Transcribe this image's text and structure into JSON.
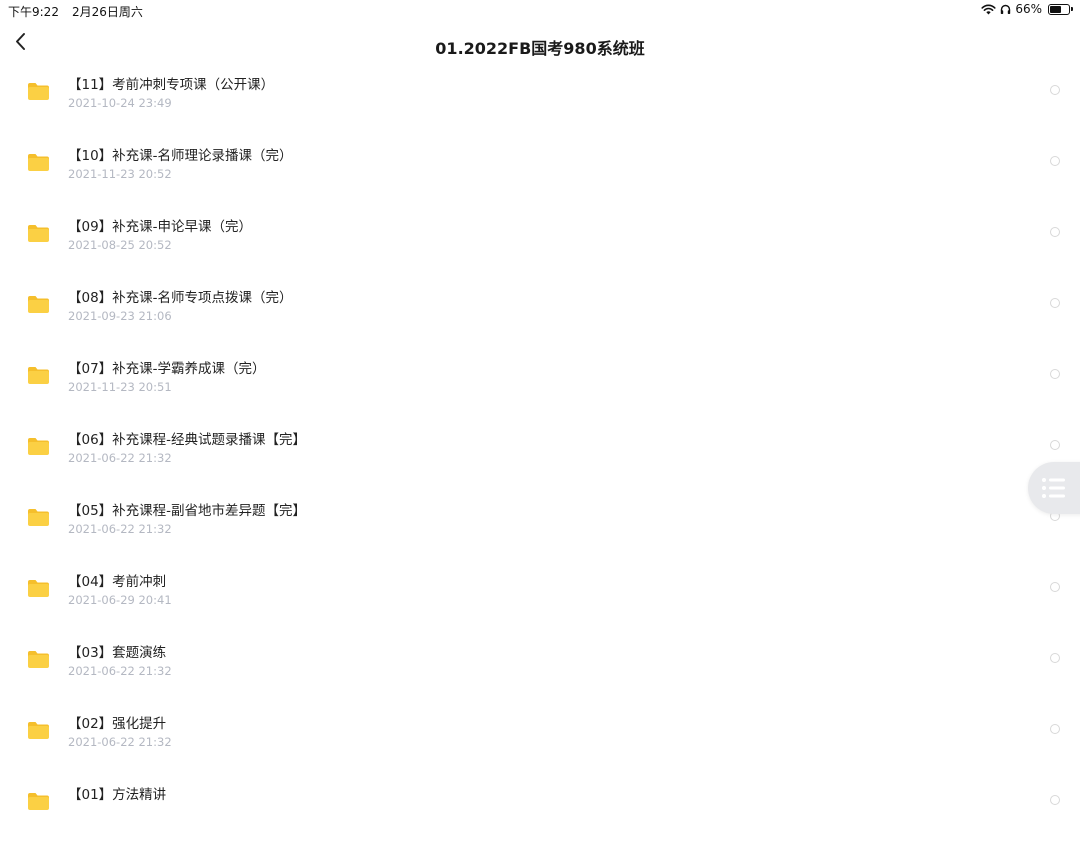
{
  "status_bar": {
    "time": "下午9:22",
    "date": "2月26日周六",
    "battery": "66%"
  },
  "nav": {
    "title": "01.2022FB国考980系统班"
  },
  "folders": [
    {
      "name": "【11】考前冲刺专项课（公开课）",
      "date": "2021-10-24 23:49"
    },
    {
      "name": "【10】补充课-名师理论录播课（完）",
      "date": "2021-11-23 20:52"
    },
    {
      "name": "【09】补充课-申论早课（完）",
      "date": "2021-08-25 20:52"
    },
    {
      "name": "【08】补充课-名师专项点拨课（完）",
      "date": "2021-09-23 21:06"
    },
    {
      "name": "【07】补充课-学霸养成课（完）",
      "date": "2021-11-23 20:51"
    },
    {
      "name": "【06】补充课程-经典试题录播课【完】",
      "date": "2021-06-22 21:32"
    },
    {
      "name": "【05】补充课程-副省地市差异题【完】",
      "date": "2021-06-22 21:32"
    },
    {
      "name": "【04】考前冲刺",
      "date": "2021-06-29 20:41"
    },
    {
      "name": "【03】套题演练",
      "date": "2021-06-22 21:32"
    },
    {
      "name": "【02】强化提升",
      "date": "2021-06-22 21:32"
    },
    {
      "name": "【01】方法精讲",
      "date": ""
    }
  ],
  "colors": {
    "folder": "#fbd044",
    "folder_tab": "#f5bf2c",
    "date_text": "#b4b8c2"
  },
  "icons": {
    "back": "chevron-left-icon",
    "folder": "folder-icon",
    "menu": "list-menu-icon",
    "wifi": "wifi-icon",
    "headphones": "headphones-icon",
    "battery": "battery-icon"
  }
}
